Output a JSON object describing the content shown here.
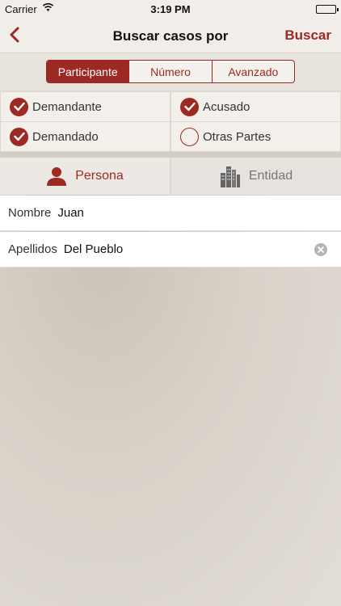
{
  "status_bar": {
    "carrier": "Carrier",
    "time": "3:19 PM"
  },
  "nav": {
    "title": "Buscar casos por",
    "action": "Buscar"
  },
  "segments": [
    {
      "label": "Participante",
      "active": true
    },
    {
      "label": "Número",
      "active": false
    },
    {
      "label": "Avanzado",
      "active": false
    }
  ],
  "checkboxes": [
    {
      "label": "Demandante",
      "checked": true
    },
    {
      "label": "Acusado",
      "checked": true
    },
    {
      "label": "Demandado",
      "checked": true
    },
    {
      "label": "Otras Partes",
      "checked": false
    }
  ],
  "type_selector": {
    "persona": "Persona",
    "entidad": "Entidad",
    "selected": "Persona"
  },
  "form": {
    "nombre": {
      "label": "Nombre",
      "value": "Juan"
    },
    "apellidos": {
      "label": "Apellidos",
      "value": "Del Pueblo"
    }
  },
  "colors": {
    "accent": "#9c2a22",
    "background": "#d8d2c9"
  }
}
